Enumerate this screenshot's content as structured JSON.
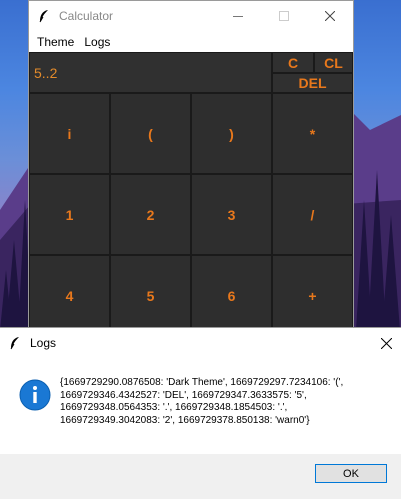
{
  "calculator": {
    "title": "Calculator",
    "menu": [
      "Theme",
      "Logs"
    ],
    "display_value": "5..2",
    "top_buttons": {
      "clear": "C",
      "clear_all": "CL",
      "delete": "DEL"
    },
    "keys": [
      [
        "i",
        "(",
        ")",
        "*"
      ],
      [
        "1",
        "2",
        "3",
        "/"
      ],
      [
        "4",
        "5",
        "6",
        "+"
      ]
    ],
    "colors": {
      "accent": "#e8781c",
      "body": "#2e2e2e"
    }
  },
  "logs_dialog": {
    "title": "Logs",
    "message": "{1669729290.0876508: 'Dark Theme', 1669729297.7234106: '(',\n1669729346.4342527: 'DEL', 1669729347.3633575: '5',\n1669729348.0564353: '.', 1669729348.1854503: '.',\n1669729349.3042083: '2', 1669729378.850138: 'warn0'}",
    "ok_label": "OK",
    "icon": "info-icon"
  }
}
